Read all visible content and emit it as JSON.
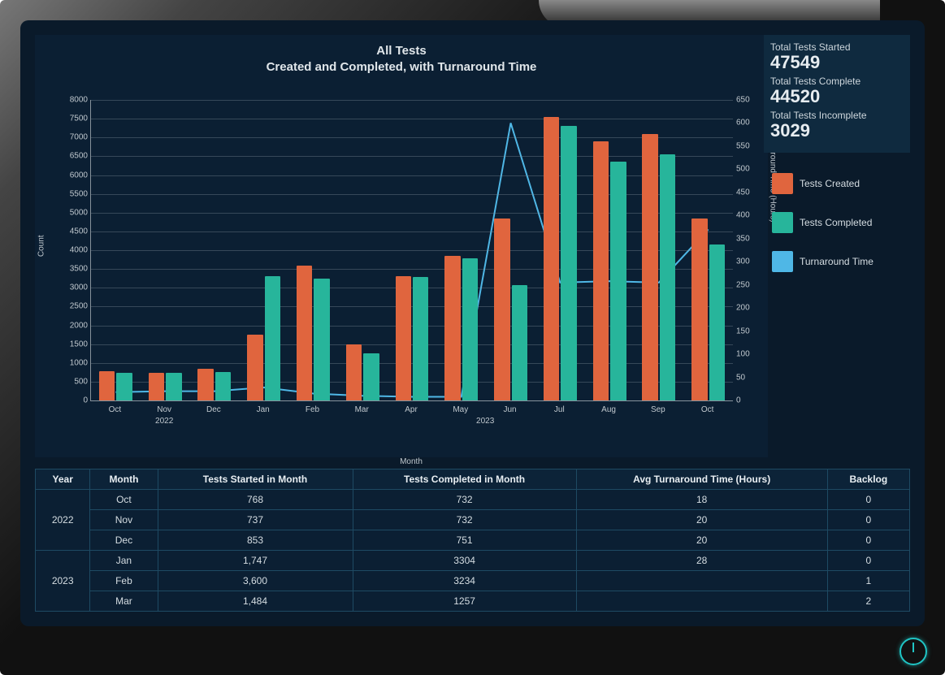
{
  "chart_data": {
    "type": "bar",
    "title_line1": "All Tests",
    "title_line2": "Created and Completed, with Turnaround Time",
    "xlabel": "Month",
    "ylabel_left": "Count",
    "ylabel_right": "Turnaround Time (Hours)",
    "ylim_left": [
      0,
      8000
    ],
    "ylim_right": [
      0,
      650
    ],
    "categories": [
      "Oct",
      "Nov",
      "Dec",
      "Jan",
      "Feb",
      "Mar",
      "Apr",
      "May",
      "Jun",
      "Jul",
      "Aug",
      "Sep",
      "Oct"
    ],
    "year_groups": [
      {
        "label": "2022",
        "start": 0,
        "end": 2
      },
      {
        "label": "2023",
        "start": 3,
        "end": 12
      }
    ],
    "series": [
      {
        "name": "Tests Created",
        "key": "created",
        "values": [
          768,
          737,
          853,
          1747,
          3600,
          1484,
          3300,
          3850,
          4850,
          7550,
          6900,
          7100,
          4850
        ]
      },
      {
        "name": "Tests Completed",
        "key": "completed",
        "values": [
          732,
          732,
          751,
          3304,
          3234,
          1257,
          3280,
          3780,
          3080,
          7300,
          6350,
          6550,
          4150
        ]
      }
    ],
    "line_series": {
      "name": "Turnaround Time",
      "key": "turn",
      "values": [
        18,
        20,
        20,
        28,
        15,
        10,
        8,
        8,
        600,
        255,
        258,
        255,
        370
      ]
    },
    "left_ticks": [
      0,
      500,
      1000,
      1500,
      2000,
      2500,
      3000,
      3500,
      4000,
      4500,
      5000,
      5500,
      6000,
      6500,
      7000,
      7500,
      8000
    ],
    "right_ticks": [
      0,
      50,
      100,
      150,
      200,
      250,
      300,
      350,
      400,
      450,
      500,
      550,
      600,
      650
    ]
  },
  "stats": {
    "started_label": "Total Tests Started",
    "started_value": "47549",
    "complete_label": "Total Tests Complete",
    "complete_value": "44520",
    "incomplete_label": "Total Tests Incomplete",
    "incomplete_value": "3029"
  },
  "legend": {
    "created": "Tests Created",
    "completed": "Tests Completed",
    "turn": "Turnaround Time"
  },
  "table": {
    "headers": [
      "Year",
      "Month",
      "Tests Started in Month",
      "Tests Completed in Month",
      "Avg Turnaround Time (Hours)",
      "Backlog"
    ],
    "rows": [
      {
        "year": "2022",
        "year_rowspan": 3,
        "month": "Oct",
        "started": "768",
        "completed": "732",
        "turn": "18",
        "backlog": "0"
      },
      {
        "year": "",
        "month": "Nov",
        "started": "737",
        "completed": "732",
        "turn": "20",
        "backlog": "0"
      },
      {
        "year": "",
        "month": "Dec",
        "started": "853",
        "completed": "751",
        "turn": "20",
        "backlog": "0"
      },
      {
        "year": "2023",
        "year_rowspan": 3,
        "month": "Jan",
        "started": "1,747",
        "completed": "3304",
        "turn": "28",
        "backlog": "0"
      },
      {
        "year": "",
        "month": "Feb",
        "started": "3,600",
        "completed": "3234",
        "turn": "",
        "backlog": "1"
      },
      {
        "year": "",
        "month": "Mar",
        "started": "1,484",
        "completed": "1257",
        "turn": "",
        "backlog": "2"
      }
    ]
  },
  "colors": {
    "created": "#e0653e",
    "completed": "#27b59b",
    "turn": "#4fb7e6"
  }
}
